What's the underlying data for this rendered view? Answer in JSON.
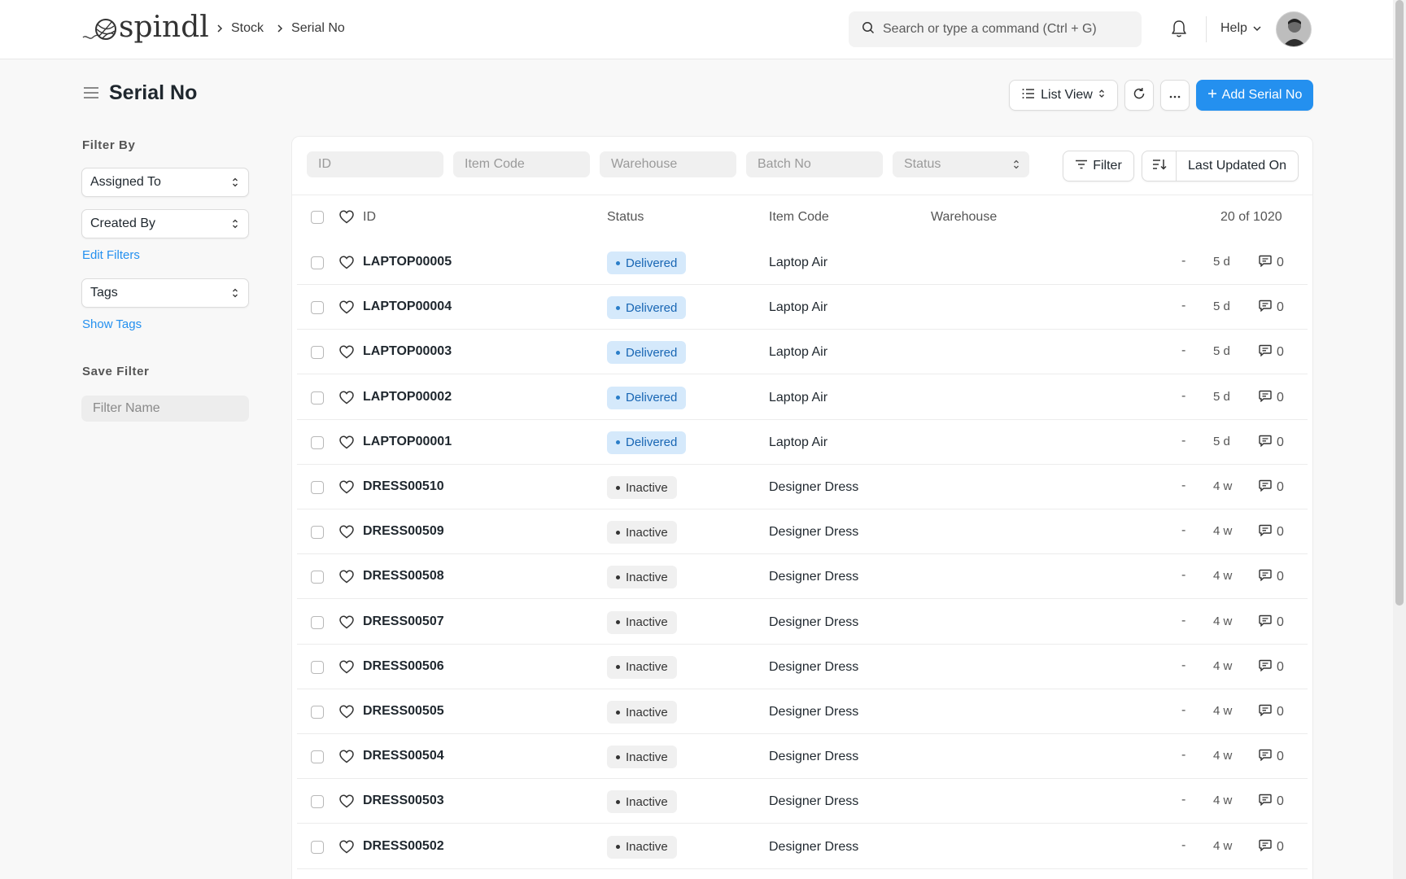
{
  "app": {
    "logo_text": "spindl"
  },
  "breadcrumbs": [
    "Stock",
    "Serial No"
  ],
  "search": {
    "placeholder": "Search or type a command (Ctrl + G)"
  },
  "nav": {
    "help_label": "Help"
  },
  "page": {
    "title": "Serial No",
    "list_view_label": "List View",
    "add_button_label": "Add Serial No"
  },
  "sidebar": {
    "filter_by_heading": "Filter By",
    "assigned_to": "Assigned To",
    "created_by": "Created By",
    "edit_filters": "Edit Filters",
    "tags": "Tags",
    "show_tags": "Show Tags",
    "save_filter_heading": "Save Filter",
    "filter_name_placeholder": "Filter Name"
  },
  "filters": {
    "id_placeholder": "ID",
    "item_code_placeholder": "Item Code",
    "warehouse_placeholder": "Warehouse",
    "batch_no_placeholder": "Batch No",
    "status_placeholder": "Status",
    "filter_button": "Filter",
    "sort_label": "Last Updated On"
  },
  "table": {
    "headers": {
      "id": "ID",
      "status": "Status",
      "item_code": "Item Code",
      "warehouse": "Warehouse",
      "count": "20 of 1020"
    },
    "rows": [
      {
        "id": "LAPTOP00005",
        "status": "Delivered",
        "item_code": "Laptop Air",
        "dash": "-",
        "age": "5 d",
        "comments": "0"
      },
      {
        "id": "LAPTOP00004",
        "status": "Delivered",
        "item_code": "Laptop Air",
        "dash": "-",
        "age": "5 d",
        "comments": "0"
      },
      {
        "id": "LAPTOP00003",
        "status": "Delivered",
        "item_code": "Laptop Air",
        "dash": "-",
        "age": "5 d",
        "comments": "0"
      },
      {
        "id": "LAPTOP00002",
        "status": "Delivered",
        "item_code": "Laptop Air",
        "dash": "-",
        "age": "5 d",
        "comments": "0"
      },
      {
        "id": "LAPTOP00001",
        "status": "Delivered",
        "item_code": "Laptop Air",
        "dash": "-",
        "age": "5 d",
        "comments": "0"
      },
      {
        "id": "DRESS00510",
        "status": "Inactive",
        "item_code": "Designer Dress",
        "dash": "-",
        "age": "4 w",
        "comments": "0"
      },
      {
        "id": "DRESS00509",
        "status": "Inactive",
        "item_code": "Designer Dress",
        "dash": "-",
        "age": "4 w",
        "comments": "0"
      },
      {
        "id": "DRESS00508",
        "status": "Inactive",
        "item_code": "Designer Dress",
        "dash": "-",
        "age": "4 w",
        "comments": "0"
      },
      {
        "id": "DRESS00507",
        "status": "Inactive",
        "item_code": "Designer Dress",
        "dash": "-",
        "age": "4 w",
        "comments": "0"
      },
      {
        "id": "DRESS00506",
        "status": "Inactive",
        "item_code": "Designer Dress",
        "dash": "-",
        "age": "4 w",
        "comments": "0"
      },
      {
        "id": "DRESS00505",
        "status": "Inactive",
        "item_code": "Designer Dress",
        "dash": "-",
        "age": "4 w",
        "comments": "0"
      },
      {
        "id": "DRESS00504",
        "status": "Inactive",
        "item_code": "Designer Dress",
        "dash": "-",
        "age": "4 w",
        "comments": "0"
      },
      {
        "id": "DRESS00503",
        "status": "Inactive",
        "item_code": "Designer Dress",
        "dash": "-",
        "age": "4 w",
        "comments": "0"
      },
      {
        "id": "DRESS00502",
        "status": "Inactive",
        "item_code": "Designer Dress",
        "dash": "-",
        "age": "4 w",
        "comments": "0"
      }
    ]
  },
  "colors": {
    "accent": "#2490ef",
    "delivered_bg": "#d5e9fb",
    "delivered_text": "#1866b4",
    "inactive_bg": "#f0f0f0"
  },
  "icons": [
    "yarn-ball-logo",
    "chevron-right-icon",
    "search-icon",
    "bell-icon",
    "chevron-down-icon",
    "menu-icon",
    "list-icon",
    "sort-caret-icon",
    "refresh-icon",
    "more-icon",
    "plus-icon",
    "filter-icon",
    "sort-direction-icon",
    "heart-icon",
    "comment-icon"
  ]
}
